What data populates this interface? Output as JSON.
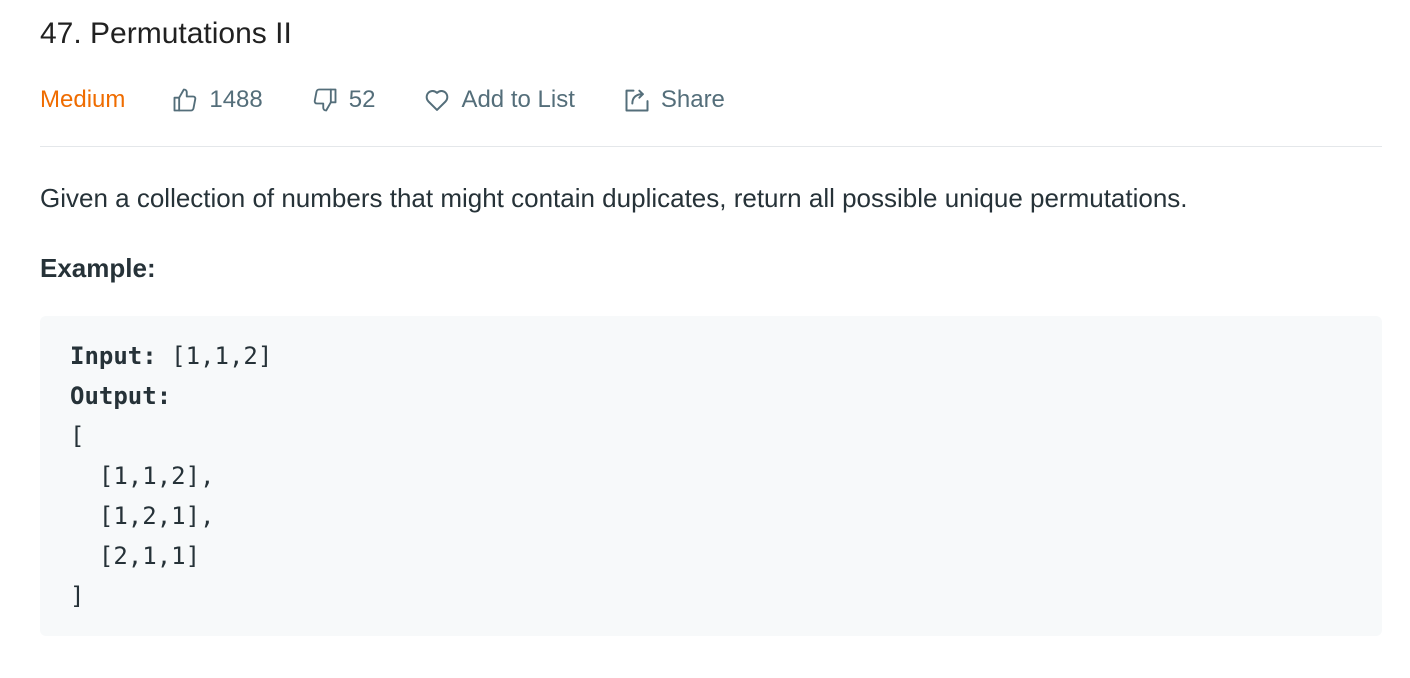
{
  "problem": {
    "title": "47. Permutations II",
    "difficulty": "Medium",
    "likes": "1488",
    "dislikes": "52",
    "add_to_list_label": "Add to List",
    "share_label": "Share",
    "description": "Given a collection of numbers that might contain duplicates, return all possible unique permutations.",
    "example_heading": "Example:"
  },
  "example": {
    "input_label": "Input:",
    "input_value": " [1,1,2]",
    "output_label": "Output:",
    "lines": [
      "[",
      "  [1,1,2],",
      "  [1,2,1],",
      "  [2,1,1]",
      "]"
    ]
  },
  "colors": {
    "difficulty_medium": "#ef6c00",
    "meta_text": "#546e7a",
    "code_background": "#f7f9fa"
  },
  "icons": {
    "like": "thumbs-up-icon",
    "dislike": "thumbs-down-icon",
    "add_to_list": "heart-icon",
    "share": "share-icon"
  }
}
